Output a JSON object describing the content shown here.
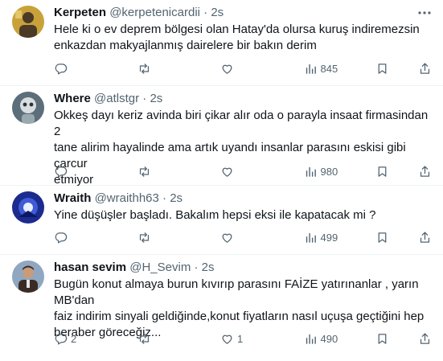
{
  "tweets": [
    {
      "name": "Kerpeten",
      "handle": "@kerpetenicardii",
      "time": "2s",
      "text": "Hele ki o ev deprem bölgesi olan Hatay'da olursa kuruş indiremezsin\nenkazdan makyajlanmış dairelere bir bakın derim",
      "replies": "",
      "retweets": "",
      "likes": "",
      "views": "845",
      "avatar_colors": [
        "#c9a13b",
        "#4a3a26"
      ]
    },
    {
      "name": "Where",
      "handle": "@atlstgr",
      "time": "2s",
      "text": "Okkeş dayı keriz avinda  biri çikar alır oda o parayla insaat firmasindan 2\ntane alirim hayalinde ama artık uyandı insanlar parasını eskisi gibi çarcur\netmiyor",
      "replies": "",
      "retweets": "",
      "likes": "",
      "views": "980",
      "avatar_colors": [
        "#5b6e7a",
        "#d9dde0"
      ]
    },
    {
      "name": "Wraith",
      "handle": "@wraithh63",
      "time": "2s",
      "text": "Yine düşüşler başladı. Bakalım hepsi eksi ile kapatacak mi ?",
      "replies": "",
      "retweets": "",
      "likes": "",
      "views": "499",
      "avatar_colors": [
        "#1b2b8f",
        "#e8efff"
      ]
    },
    {
      "name": "hasan sevim",
      "handle": "@H_Sevim",
      "time": "2s",
      "text": "Bugün konut almaya burun kıvırıp parasını FAİZE yatırınanlar , yarın MB'dan\nfaiz indirim sinyali geldiğinde,konut fiyatların nasıl uçuşa geçtiğini hep\nberaber göreceğiz...",
      "replies": "2",
      "retweets": "",
      "likes": "1",
      "views": "490",
      "avatar_colors": [
        "#8fa7c0",
        "#3a2c24"
      ]
    }
  ],
  "icons": {
    "more": "more-horizontal-icon",
    "reply": "reply-icon",
    "retweet": "retweet-icon",
    "like": "heart-icon",
    "views": "views-icon",
    "bookmark": "bookmark-icon",
    "share": "share-icon"
  }
}
